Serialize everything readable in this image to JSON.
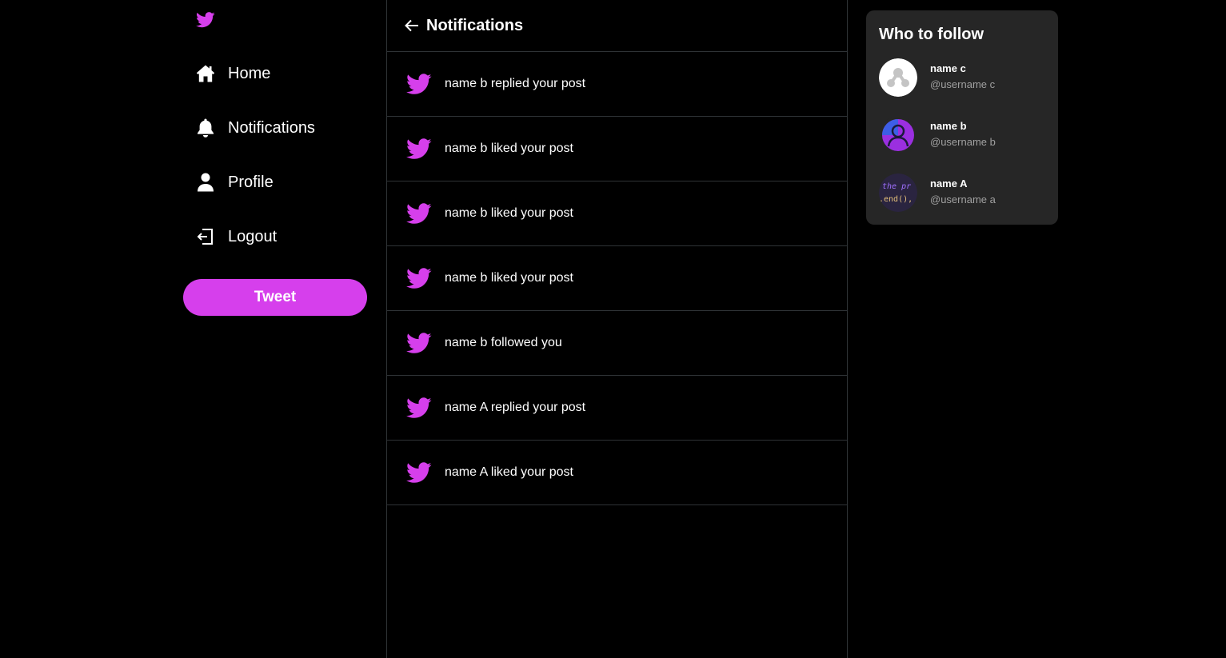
{
  "theme": {
    "accent": "#d63fec",
    "background": "#000000",
    "panel": "#262626",
    "divider": "#2f3336",
    "muted_text": "#a0a0a0"
  },
  "sidebar": {
    "logo_icon": "bird-logo-icon",
    "items": [
      {
        "label": "Home",
        "icon": "home-icon"
      },
      {
        "label": "Notifications",
        "icon": "bell-icon"
      },
      {
        "label": "Profile",
        "icon": "user-icon"
      },
      {
        "label": "Logout",
        "icon": "logout-icon"
      }
    ],
    "tweet_label": "Tweet"
  },
  "main": {
    "back_icon": "arrow-left-icon",
    "title": "Notifications",
    "notifications": [
      {
        "text": "name b replied your post",
        "icon": "bird-icon"
      },
      {
        "text": "name b liked your post",
        "icon": "bird-icon"
      },
      {
        "text": "name b liked your post",
        "icon": "bird-icon"
      },
      {
        "text": "name b liked your post",
        "icon": "bird-icon"
      },
      {
        "text": "name b followed you",
        "icon": "bird-icon"
      },
      {
        "text": "name A replied your post",
        "icon": "bird-icon"
      },
      {
        "text": "name A liked your post",
        "icon": "bird-icon"
      }
    ]
  },
  "who_to_follow": {
    "title": "Who to follow",
    "users": [
      {
        "name": "name c",
        "username": "@username c",
        "avatar": "default-avatar"
      },
      {
        "name": "name b",
        "username": "@username b",
        "avatar": "purple-person-avatar"
      },
      {
        "name": "name A",
        "username": "@username a",
        "avatar": "code-snippet-avatar",
        "avatar_text_1": "the pr",
        "avatar_text_2": ".end(),"
      }
    ]
  }
}
